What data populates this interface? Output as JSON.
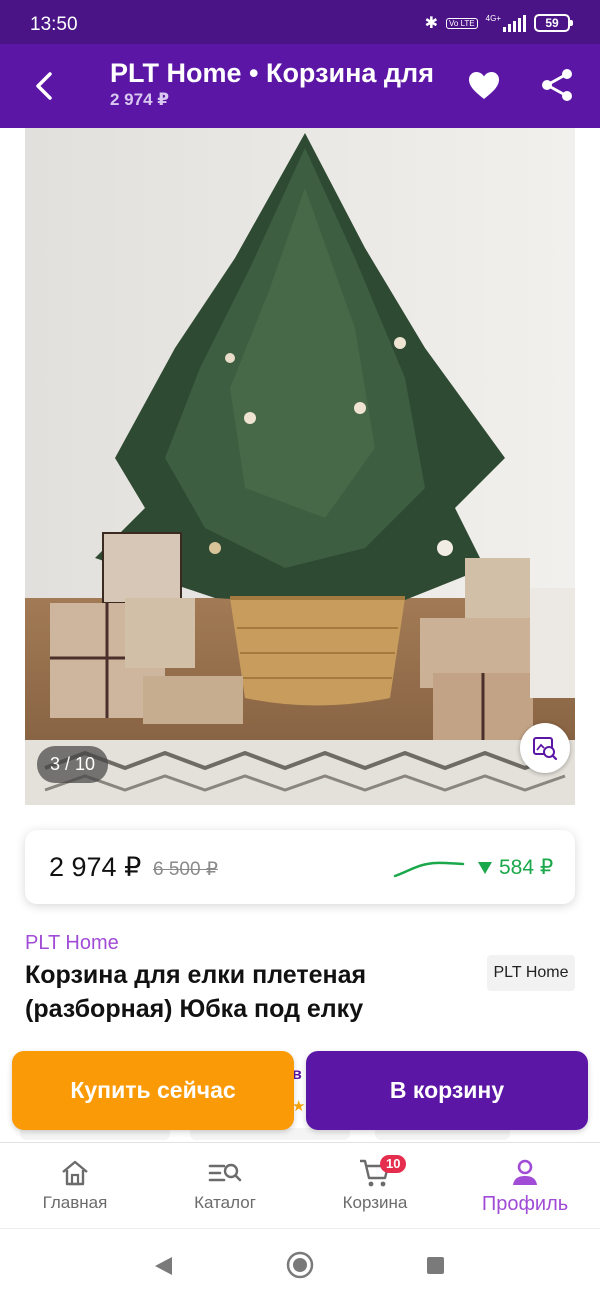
{
  "status_bar": {
    "time": "13:50",
    "network": "4G+",
    "volte": "Vo LTE",
    "battery": "59"
  },
  "header": {
    "title": "PLT Home • Корзина для елки плетеная (разборная) Юбка под елку",
    "subtitle_price": "2 974 ₽",
    "back_icon": "arrow-left-icon",
    "favorite_icon": "heart-icon",
    "share_icon": "share-icon"
  },
  "gallery": {
    "counter": "3 / 10",
    "lens_icon": "image-search-icon"
  },
  "price": {
    "current": "2 974 ₽",
    "old": "6 500 ₽",
    "drop": "584 ₽",
    "trend_icon": "price-trend-sparkline",
    "drop_color": "#1aa84a"
  },
  "product": {
    "brand": "PLT Home",
    "name": "Корзина для елки плетеная (разборная)  Юбка под елку",
    "seller_badge": "PLT Home"
  },
  "actions": {
    "buy_now": "Купить сейчас",
    "add_to_cart": "В корзину",
    "peek_text": "в"
  },
  "bottom_nav": {
    "items": [
      {
        "label": "Главная",
        "icon": "home-icon"
      },
      {
        "label": "Каталог",
        "icon": "catalog-search-icon"
      },
      {
        "label": "Корзина",
        "icon": "cart-icon",
        "badge": "10"
      },
      {
        "label": "Профиль",
        "icon": "profile-icon",
        "active": true
      }
    ]
  },
  "colors": {
    "brand_purple": "#5b16a6",
    "accent_orange": "#fa9a07",
    "brand_label": "#a04cd6",
    "badge_red": "#e52e4d"
  }
}
